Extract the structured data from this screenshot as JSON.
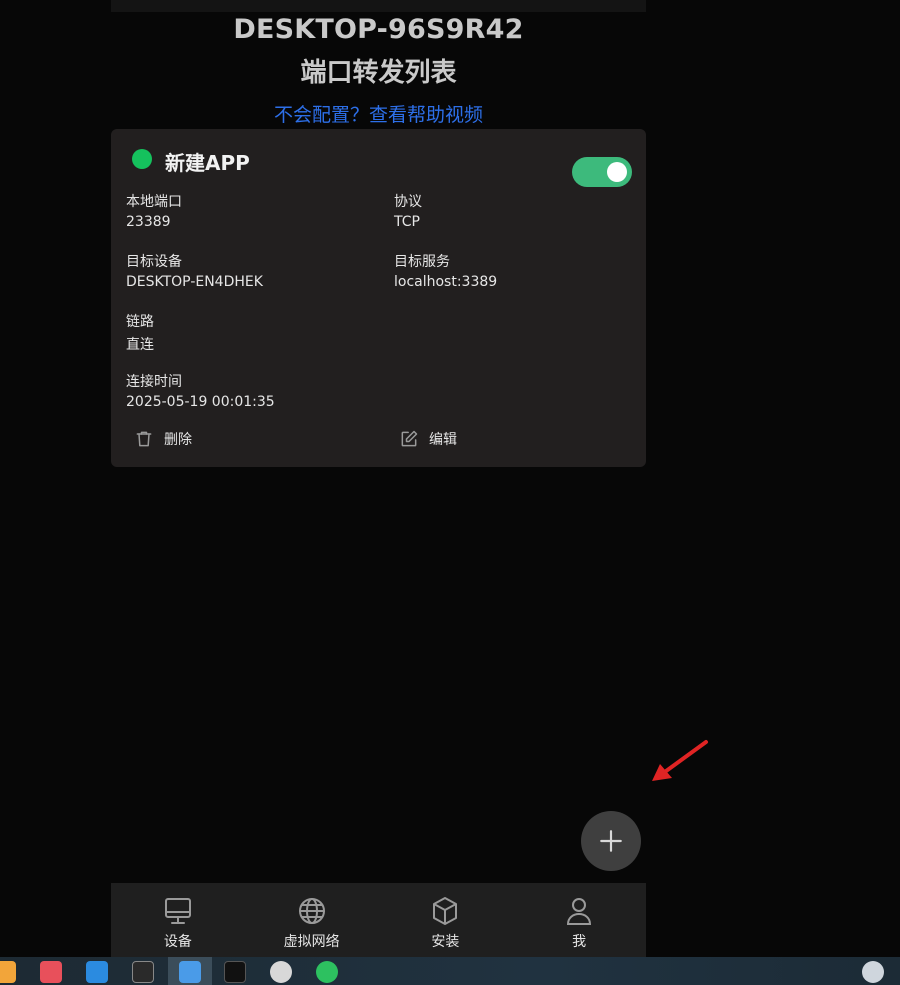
{
  "header": {
    "host": "DESKTOP-96S9R42",
    "title": "端口转发列表",
    "help_link": "不会配置？查看帮助视频"
  },
  "card": {
    "name": "新建APP",
    "status_color": "#15c15d",
    "toggle_on": true,
    "fields": {
      "local_port_label": "本地端口",
      "local_port_value": "23389",
      "protocol_label": "协议",
      "protocol_value": "TCP",
      "target_device_label": "目标设备",
      "target_device_value": "DESKTOP-EN4DHEK",
      "target_service_label": "目标服务",
      "target_service_value": "localhost:3389",
      "link_label": "链路",
      "link_value": "直连",
      "connect_time_label": "连接时间",
      "connect_time_value": "2025-05-19 00:01:35"
    },
    "actions": {
      "delete_label": "删除",
      "edit_label": "编辑"
    }
  },
  "fab": {
    "icon": "plus-icon"
  },
  "nav": {
    "items": [
      {
        "label": "设备",
        "icon": "monitor-icon"
      },
      {
        "label": "虚拟网络",
        "icon": "globe-icon"
      },
      {
        "label": "安装",
        "icon": "package-icon"
      },
      {
        "label": "我",
        "icon": "user-icon"
      }
    ]
  },
  "colors": {
    "background": "#070707",
    "card": "#221f1f",
    "accent_green": "#3dba7c",
    "link_blue": "#2d6fe8",
    "annotation_red": "#e02424"
  }
}
